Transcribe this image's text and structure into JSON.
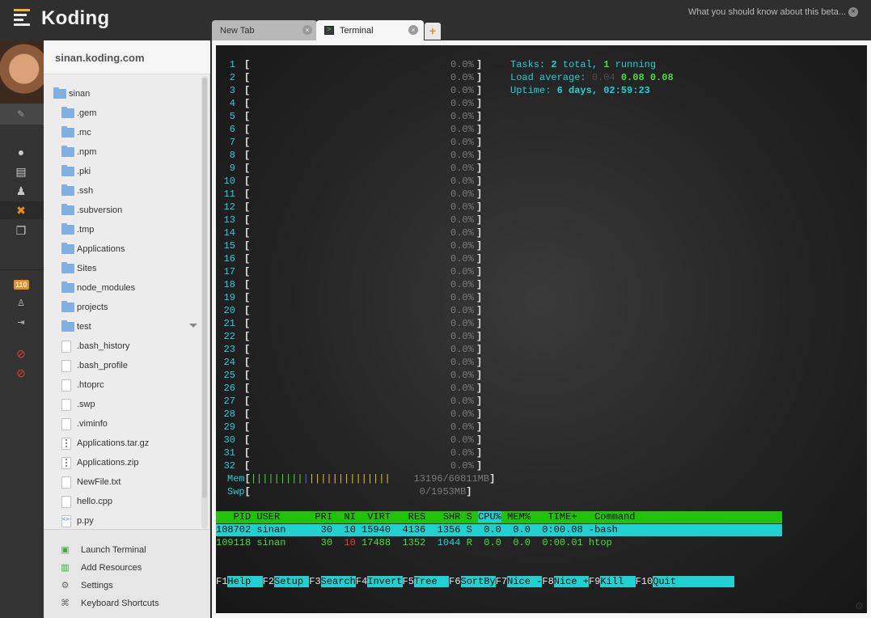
{
  "app": {
    "brand": "Koding",
    "beta_link": "What you should know about this beta...",
    "beta_close": "×"
  },
  "rail": {
    "notifications_badge": "110"
  },
  "tree": {
    "user_host": "sinan.koding.com",
    "items": [
      {
        "label": "sinan",
        "type": "folder",
        "indent": 0
      },
      {
        "label": ".gem",
        "type": "folder",
        "indent": 1
      },
      {
        "label": ".mc",
        "type": "folder",
        "indent": 1
      },
      {
        "label": ".npm",
        "type": "folder",
        "indent": 1
      },
      {
        "label": ".pki",
        "type": "folder",
        "indent": 1
      },
      {
        "label": ".ssh",
        "type": "folder",
        "indent": 1
      },
      {
        "label": ".subversion",
        "type": "folder",
        "indent": 1
      },
      {
        "label": ".tmp",
        "type": "folder",
        "indent": 1
      },
      {
        "label": "Applications",
        "type": "folder",
        "indent": 1
      },
      {
        "label": "Sites",
        "type": "folder",
        "indent": 1
      },
      {
        "label": "node_modules",
        "type": "folder",
        "indent": 1
      },
      {
        "label": "projects",
        "type": "folder",
        "indent": 1
      },
      {
        "label": "test",
        "type": "folder",
        "indent": 1
      },
      {
        "label": ".bash_history",
        "type": "file",
        "indent": 1
      },
      {
        "label": ".bash_profile",
        "type": "file",
        "indent": 1
      },
      {
        "label": ".htoprc",
        "type": "file",
        "indent": 1
      },
      {
        "label": ".swp",
        "type": "file",
        "indent": 1
      },
      {
        "label": ".viminfo",
        "type": "file",
        "indent": 1
      },
      {
        "label": "Applications.tar.gz",
        "type": "zip",
        "indent": 1
      },
      {
        "label": "Applications.zip",
        "type": "zip",
        "indent": 1
      },
      {
        "label": "NewFile.txt",
        "type": "file",
        "indent": 1
      },
      {
        "label": "hello.cpp",
        "type": "file",
        "indent": 1
      },
      {
        "label": "p.py",
        "type": "code",
        "indent": 1
      }
    ],
    "footer": [
      {
        "label": "Launch Terminal",
        "icon": "terminal-icon"
      },
      {
        "label": "Add Resources",
        "icon": "bar-chart-icon"
      },
      {
        "label": "Settings",
        "icon": "gear-icon"
      },
      {
        "label": "Keyboard Shortcuts",
        "icon": "command-key-icon"
      }
    ]
  },
  "tabs": {
    "new_tab": "New Tab",
    "terminal": "Terminal",
    "close": "×",
    "add": "+"
  },
  "htop": {
    "cpu_count": 32,
    "cpu_percent": "0.0%",
    "tasks_label": "Tasks:",
    "tasks_total": "2",
    "tasks_total_word": "total,",
    "tasks_running": "1",
    "tasks_running_word": "running",
    "load_label": "Load average:",
    "load1": "0.04",
    "load5": "0.08",
    "load15": "0.08",
    "uptime_label": "Uptime:",
    "uptime_value": "6 days, 02:59:23",
    "mem_label": "Mem",
    "mem_value": "13196/60811MB",
    "swp_label": "Swp",
    "swp_value": "0/1953MB",
    "columns": [
      "PID",
      "USER",
      "PRI",
      "NI",
      "VIRT",
      "RES",
      "SHR",
      "S",
      "CPU%",
      "MEM%",
      "TIME+",
      "Command"
    ],
    "processes": [
      {
        "pid": "108702",
        "user": "sinan",
        "pri": "30",
        "ni": "10",
        "virt": "15940",
        "res": "4136",
        "shr": "1356",
        "s": "S",
        "cpu": "0.0",
        "mem": "0.0",
        "time": "0:00.08",
        "cmd": "-bash"
      },
      {
        "pid": "109118",
        "user": "sinan",
        "pri": "30",
        "ni": "10",
        "virt": "17488",
        "res": "1352",
        "shr": "1044",
        "s": "R",
        "cpu": "0.0",
        "mem": "0.0",
        "time": "0:00.01",
        "cmd": "htop"
      }
    ],
    "fkeys": [
      {
        "key": "F1",
        "label": "Help  "
      },
      {
        "key": "F2",
        "label": "Setup "
      },
      {
        "key": "F3",
        "label": "Search"
      },
      {
        "key": "F4",
        "label": "Invert"
      },
      {
        "key": "F5",
        "label": "Tree  "
      },
      {
        "key": "F6",
        "label": "SortBy"
      },
      {
        "key": "F7",
        "label": "Nice -"
      },
      {
        "key": "F8",
        "label": "Nice +"
      },
      {
        "key": "F9",
        "label": "Kill  "
      },
      {
        "key": "F10",
        "label": "Quit          "
      }
    ]
  }
}
